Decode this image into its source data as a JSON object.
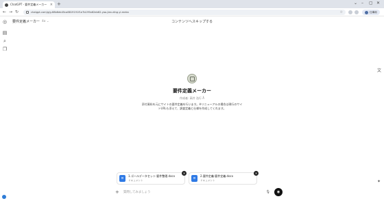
{
  "browser": {
    "tab_title": "ChatGPT - 要件定義メーカー",
    "tab_close": "×",
    "new_tab": "+",
    "window_controls": [
      "⌄",
      "–",
      "▢",
      "✕"
    ],
    "url": "chatgpt.com/g/g-68b6eb45ca8819191f1e7b199a62eb62-yao-jian-ding-yi-meka",
    "profile_label": "仕事用"
  },
  "header": {
    "gpt_title": "要件定義メーカー",
    "model_label": "4o ⌄",
    "skip_link": "コンテンツへスキップする"
  },
  "gpt": {
    "name": "要件定義メーカー",
    "author": "作成者: 高井 浩行 Å",
    "description_line1": "添付資料を元にサイトの要件定義を行います。※リニューアルの場合は現行のサイ",
    "description_line2": "トURLも添えて、調査定義と仕様を作成してくれます。"
  },
  "attachments": [
    {
      "name": "1.ゴールデータセット-要件整理.docx",
      "type": "ドキュメント"
    },
    {
      "name": "2.要件定義-要件定義.docx",
      "type": "ドキュメント"
    }
  ],
  "composer": {
    "plus": "+",
    "placeholder": "質問してみましょう"
  },
  "icons": {
    "sidebar": [
      "sidebar-toggle-icon",
      "search-icon",
      "library-icon"
    ],
    "accent": "#2f7ae5"
  }
}
